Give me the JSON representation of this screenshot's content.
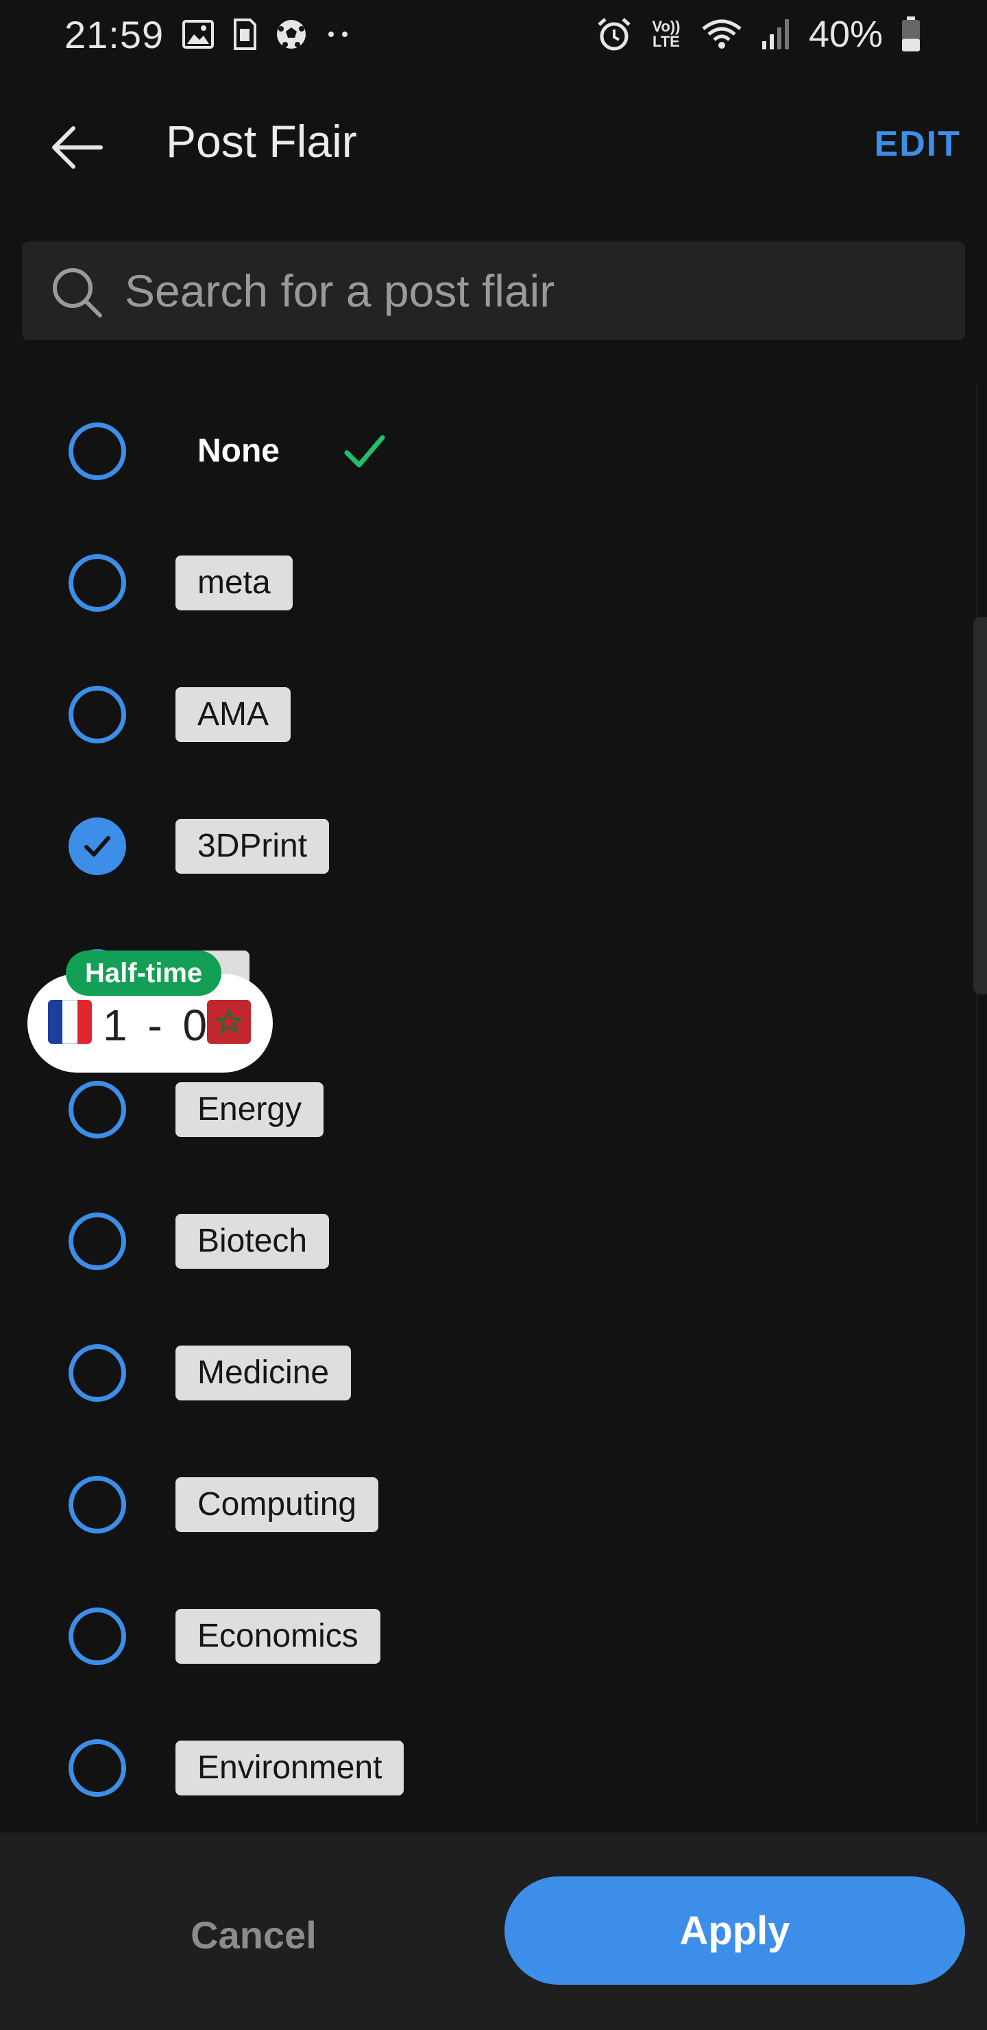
{
  "status_bar": {
    "time": "21:59",
    "left_icons": [
      "gallery-icon",
      "sim-card-icon",
      "soccer-ball-icon",
      "more-dots-icon"
    ],
    "right_icons": [
      "alarm-icon",
      "volte-icon",
      "wifi-icon",
      "signal-icon",
      "battery-icon"
    ],
    "volte_label": "Vo)) LTE",
    "battery_percent": "40%",
    "battery_level": 0.4
  },
  "header": {
    "title": "Post Flair",
    "edit_label": "EDIT"
  },
  "search": {
    "placeholder": "Search for a post flair"
  },
  "flairs": [
    {
      "label": "None",
      "selected": false,
      "style": "plain",
      "current": true
    },
    {
      "label": "meta",
      "selected": false,
      "style": "chip"
    },
    {
      "label": "AMA",
      "selected": false,
      "style": "chip"
    },
    {
      "label": "3DPrint",
      "selected": true,
      "style": "chip"
    },
    {
      "label": "",
      "selected": false,
      "style": "chip",
      "partially_hidden": true
    },
    {
      "label": "Energy",
      "selected": false,
      "style": "chip"
    },
    {
      "label": "Biotech",
      "selected": false,
      "style": "chip"
    },
    {
      "label": "Medicine",
      "selected": false,
      "style": "chip"
    },
    {
      "label": "Computing",
      "selected": false,
      "style": "chip"
    },
    {
      "label": "Economics",
      "selected": false,
      "style": "chip"
    },
    {
      "label": "Environment",
      "selected": false,
      "style": "chip"
    }
  ],
  "score_overlay": {
    "badge": "Half-time",
    "score": "1 - 0",
    "home_flag": "france-flag",
    "away_flag": "morocco-flag"
  },
  "footer": {
    "cancel_label": "Cancel",
    "apply_label": "Apply"
  },
  "colors": {
    "background": "#121212",
    "accent": "#3d8ee8",
    "chip_bg": "#dedede",
    "check_green": "#1fc16b",
    "halftime_green": "#13a056"
  }
}
